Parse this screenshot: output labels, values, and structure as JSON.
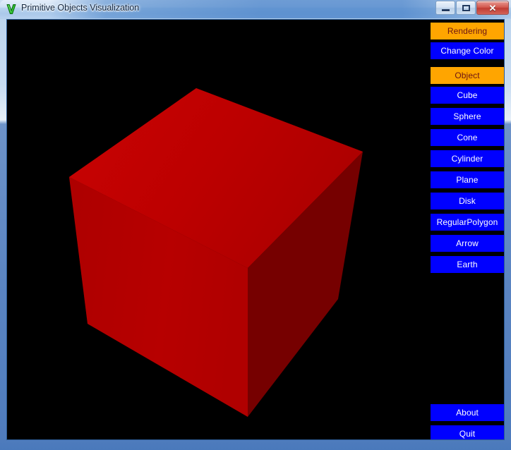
{
  "window": {
    "title": "Primitive Objects Visualization",
    "icon": "v-logo-icon",
    "caption": {
      "minimize_label": "–",
      "maximize_label": "",
      "close_label": "✕"
    }
  },
  "panel": {
    "groups": [
      {
        "header": "Rendering",
        "buttons": [
          {
            "label": "Change Color"
          }
        ]
      },
      {
        "header": "Object",
        "buttons": [
          {
            "label": "Cube"
          },
          {
            "label": "Sphere"
          },
          {
            "label": "Cone"
          },
          {
            "label": "Cylinder"
          },
          {
            "label": "Plane"
          },
          {
            "label": "Disk"
          },
          {
            "label": "RegularPolygon"
          },
          {
            "label": "Arrow"
          },
          {
            "label": "Earth"
          }
        ]
      }
    ],
    "footer_buttons": [
      {
        "label": "About"
      },
      {
        "label": "Quit"
      }
    ]
  },
  "viewport": {
    "background_color": "#000000",
    "object": "cube",
    "object_color": "#c00000",
    "faces": {
      "top_color": "#be0000",
      "front_color": "#b50000",
      "right_color": "#7a0000"
    }
  },
  "colors": {
    "button_blue": "#0000ff",
    "button_blue_text": "#ffffff",
    "header_orange": "#ffa500",
    "header_orange_text": "#6b1414",
    "canvas_black": "#000000",
    "frame_blue": "#5b85c2"
  }
}
